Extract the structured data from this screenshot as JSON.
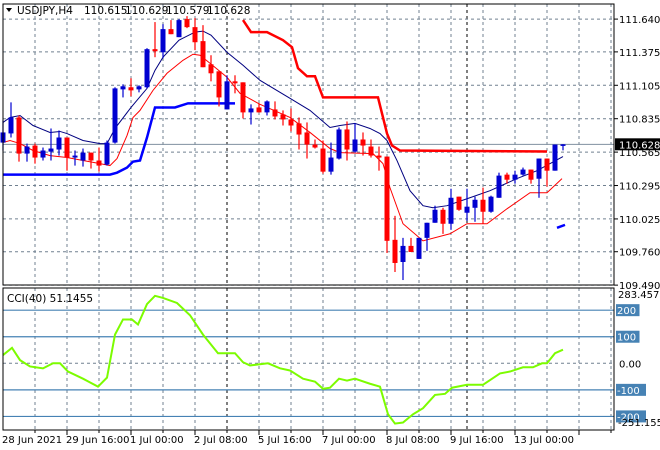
{
  "header": {
    "symbol_timeframe": "USDJPY,H4",
    "open": "110.615",
    "high": "110.629",
    "low": "110.579",
    "close": "110.628",
    "menu_icon": "triangle-down-icon"
  },
  "colors": {
    "bull": "#0000d0",
    "bear": "#ff0000",
    "ma_fast": "#000080",
    "ma_slow": "#ff0000",
    "support": "#0000ff",
    "resistance": "#ff0000",
    "cci": "#7cfc00",
    "cci_level": "#4682b4",
    "grid": "#708090"
  },
  "chart_data": {
    "type": "candlestick",
    "symbol": "USDJPY",
    "timeframe": "H4",
    "price_ylim": [
      109.491,
      111.762
    ],
    "price_ticks": [
      "111.640",
      "111.375",
      "111.105",
      "110.835",
      "110.565",
      "110.295",
      "110.025",
      "109.760",
      "109.490"
    ],
    "current_price": "110.628",
    "grid": true,
    "grid_every_bars": 4,
    "period_separators": [
      28,
      58
    ],
    "time_labels": [
      {
        "bar": 0,
        "text": "28 Jun 2021"
      },
      {
        "bar": 8,
        "text": "29 Jun 16:00"
      },
      {
        "bar": 16,
        "text": "1 Jul 00:00"
      },
      {
        "bar": 24,
        "text": "2 Jul 08:00"
      },
      {
        "bar": 32,
        "text": "5 Jul 16:00"
      },
      {
        "bar": 40,
        "text": "7 Jul 00:00"
      },
      {
        "bar": 48,
        "text": "8 Jul 08:00"
      },
      {
        "bar": 56,
        "text": "9 Jul 16:00"
      },
      {
        "bar": 64,
        "text": "13 Jul 00:00"
      }
    ],
    "candles_ohlc": [
      [
        110.642,
        110.821,
        110.578,
        110.724
      ],
      [
        110.716,
        110.967,
        110.683,
        110.845
      ],
      [
        110.845,
        110.861,
        110.488,
        110.553
      ],
      [
        110.553,
        110.634,
        110.488,
        110.61
      ],
      [
        110.618,
        110.634,
        110.472,
        110.521
      ],
      [
        110.521,
        110.602,
        110.497,
        110.578
      ],
      [
        110.569,
        110.756,
        110.497,
        110.594
      ],
      [
        110.586,
        110.74,
        110.537,
        110.683
      ],
      [
        110.683,
        110.683,
        110.415,
        110.521
      ],
      [
        110.521,
        110.578,
        110.456,
        110.537
      ],
      [
        110.497,
        110.594,
        110.448,
        110.561
      ],
      [
        110.561,
        110.561,
        110.432,
        110.497
      ],
      [
        110.497,
        110.602,
        110.407,
        110.456
      ],
      [
        110.464,
        110.659,
        110.456,
        110.642
      ],
      [
        110.642,
        111.089,
        110.634,
        111.08
      ],
      [
        111.072,
        111.113,
        111.007,
        111.097
      ],
      [
        111.089,
        111.162,
        111.016,
        111.064
      ],
      [
        111.072,
        111.105,
        111.048,
        111.097
      ],
      [
        111.089,
        111.405,
        111.08,
        111.397
      ],
      [
        111.397,
        111.616,
        111.332,
        111.38
      ],
      [
        111.372,
        111.599,
        111.324,
        111.559
      ],
      [
        111.559,
        111.632,
        111.518,
        111.518
      ],
      [
        111.494,
        111.64,
        111.494,
        111.632
      ],
      [
        111.64,
        111.664,
        111.567,
        111.575
      ],
      [
        111.575,
        111.648,
        111.389,
        111.453
      ],
      [
        111.462,
        111.591,
        111.251,
        111.251
      ],
      [
        111.275,
        111.348,
        111.137,
        111.202
      ],
      [
        111.218,
        111.218,
        110.934,
        111.007
      ],
      [
        110.91,
        111.186,
        110.91,
        111.137
      ],
      [
        111.137,
        111.186,
        111.04,
        111.121
      ],
      [
        111.129,
        111.129,
        110.837,
        110.886
      ],
      [
        110.886,
        110.951,
        110.788,
        110.918
      ],
      [
        110.926,
        110.959,
        110.886,
        110.886
      ],
      [
        110.886,
        110.983,
        110.861,
        110.975
      ],
      [
        110.91,
        110.975,
        110.829,
        110.853
      ],
      [
        110.87,
        110.902,
        110.78,
        110.829
      ],
      [
        110.829,
        110.918,
        110.732,
        110.78
      ],
      [
        110.797,
        110.845,
        110.586,
        110.707
      ],
      [
        110.724,
        110.805,
        110.513,
        110.626
      ],
      [
        110.626,
        110.667,
        110.594,
        110.602
      ],
      [
        110.594,
        110.659,
        110.391,
        110.407
      ],
      [
        110.407,
        110.642,
        110.383,
        110.521
      ],
      [
        110.513,
        110.764,
        110.505,
        110.748
      ],
      [
        110.748,
        110.813,
        110.497,
        110.586
      ],
      [
        110.569,
        110.797,
        110.561,
        110.667
      ],
      [
        110.667,
        110.724,
        110.537,
        110.618
      ],
      [
        110.61,
        110.667,
        110.521,
        110.537
      ],
      [
        110.537,
        110.61,
        110.415,
        110.521
      ],
      [
        110.529,
        110.529,
        109.75,
        109.848
      ],
      [
        109.856,
        110.05,
        109.596,
        109.669
      ],
      [
        109.677,
        109.872,
        109.531,
        109.807
      ],
      [
        109.807,
        109.872,
        109.758,
        109.758
      ],
      [
        109.702,
        109.872,
        109.702,
        109.872
      ],
      [
        109.872,
        109.994,
        109.767,
        109.994
      ],
      [
        109.994,
        110.132,
        109.994,
        110.099
      ],
      [
        110.099,
        110.115,
        109.904,
        109.986
      ],
      [
        109.986,
        110.269,
        109.937,
        110.196
      ],
      [
        110.205,
        110.205,
        110.091,
        110.099
      ],
      [
        110.075,
        110.269,
        110.01,
        110.124
      ],
      [
        110.115,
        110.205,
        110.002,
        110.18
      ],
      [
        110.18,
        110.278,
        109.986,
        110.083
      ],
      [
        110.083,
        110.213,
        110.075,
        110.205
      ],
      [
        110.196,
        110.399,
        110.196,
        110.375
      ],
      [
        110.383,
        110.399,
        110.31,
        110.342
      ],
      [
        110.342,
        110.415,
        110.31,
        110.383
      ],
      [
        110.383,
        110.44,
        110.375,
        110.424
      ],
      [
        110.424,
        110.424,
        110.31,
        110.342
      ],
      [
        110.35,
        110.513,
        110.196,
        110.513
      ],
      [
        110.513,
        110.513,
        110.286,
        110.415
      ],
      [
        110.415,
        110.626,
        110.415,
        110.626
      ],
      [
        110.615,
        110.629,
        110.579,
        110.628
      ]
    ],
    "ma_fast": [
      [
        0,
        110.805
      ],
      [
        0.875,
        110.845
      ],
      [
        2.125,
        110.861
      ],
      [
        3.75,
        110.78
      ],
      [
        5.875,
        110.724
      ],
      [
        7.125,
        110.732
      ],
      [
        8,
        110.715
      ],
      [
        10,
        110.659
      ],
      [
        12.125,
        110.634
      ],
      [
        13,
        110.634
      ],
      [
        14,
        110.756
      ],
      [
        16,
        110.926
      ],
      [
        18,
        111.08
      ],
      [
        19,
        111.226
      ],
      [
        20,
        111.332
      ],
      [
        22,
        111.47
      ],
      [
        24,
        111.535
      ],
      [
        25,
        111.543
      ],
      [
        26,
        111.51
      ],
      [
        28,
        111.372
      ],
      [
        30,
        111.267
      ],
      [
        32.125,
        111.145
      ],
      [
        35.875,
        111.0
      ],
      [
        38.375,
        110.902
      ],
      [
        40.875,
        110.764
      ],
      [
        42.125,
        110.78
      ],
      [
        44,
        110.797
      ],
      [
        45.875,
        110.756
      ],
      [
        47.125,
        110.715
      ],
      [
        48,
        110.659
      ],
      [
        49.25,
        110.497
      ],
      [
        50.875,
        110.253
      ],
      [
        52.5,
        110.132
      ],
      [
        53.75,
        110.115
      ],
      [
        55.5,
        110.132
      ],
      [
        58,
        110.188
      ],
      [
        60.875,
        110.253
      ],
      [
        64.25,
        110.351
      ],
      [
        66.75,
        110.415
      ],
      [
        70,
        110.529
      ]
    ],
    "ma_slow": [
      [
        0,
        110.642
      ],
      [
        0.875,
        110.659
      ],
      [
        2.125,
        110.634
      ],
      [
        3.75,
        110.578
      ],
      [
        5.875,
        110.537
      ],
      [
        8,
        110.521
      ],
      [
        10,
        110.497
      ],
      [
        12.125,
        110.472
      ],
      [
        13.375,
        110.456
      ],
      [
        14.25,
        110.513
      ],
      [
        15.5,
        110.699
      ],
      [
        16.25,
        110.845
      ],
      [
        17.125,
        110.902
      ],
      [
        18.75,
        111.064
      ],
      [
        20.5,
        111.202
      ],
      [
        22.5,
        111.307
      ],
      [
        23.75,
        111.356
      ],
      [
        24.625,
        111.348
      ],
      [
        25.875,
        111.283
      ],
      [
        28,
        111.17
      ],
      [
        29.625,
        111.04
      ],
      [
        32.125,
        110.951
      ],
      [
        35.875,
        110.845
      ],
      [
        38.375,
        110.724
      ],
      [
        40.875,
        110.594
      ],
      [
        42.125,
        110.561
      ],
      [
        46.25,
        110.553
      ],
      [
        47.5,
        110.472
      ],
      [
        48.375,
        110.277
      ],
      [
        50,
        109.986
      ],
      [
        52.5,
        109.848
      ],
      [
        55.875,
        109.905
      ],
      [
        58,
        109.986
      ],
      [
        60.5,
        109.986
      ],
      [
        63,
        110.107
      ],
      [
        65.875,
        110.237
      ],
      [
        68,
        110.237
      ],
      [
        69.875,
        110.351
      ]
    ],
    "support_line": [
      [
        0,
        110.383
      ],
      [
        13.375,
        110.383
      ],
      [
        14.25,
        110.399
      ],
      [
        15.5,
        110.44
      ],
      [
        16.25,
        110.488
      ],
      [
        17.125,
        110.497
      ],
      [
        18,
        110.683
      ],
      [
        19,
        110.926
      ],
      [
        21.5,
        110.926
      ],
      [
        23.125,
        110.959
      ],
      [
        29,
        110.959
      ]
    ],
    "support_line_2": [
      [
        69.25,
        109.953
      ],
      [
        70.25,
        109.977
      ]
    ],
    "resistance_line": [
      [
        30,
        111.632
      ],
      [
        31,
        111.535
      ],
      [
        33,
        111.535
      ],
      [
        35,
        111.47
      ],
      [
        36.125,
        111.413
      ],
      [
        36.875,
        111.243
      ],
      [
        38,
        111.178
      ],
      [
        39,
        111.178
      ],
      [
        40,
        111.007
      ],
      [
        46.875,
        111.007
      ],
      [
        48,
        110.716
      ],
      [
        48.625,
        110.618
      ],
      [
        49.625,
        110.578
      ],
      [
        68,
        110.57
      ]
    ],
    "cci": {
      "label": "CCI(40) 51.1455",
      "ylim": [
        -251.1553,
        283.4578
      ],
      "max_label": "283.4578",
      "min_label": "-251.1553",
      "levels": [
        "200",
        "100",
        "-100",
        "-200"
      ],
      "zero_label": "0.00",
      "points": [
        [
          0,
          31
        ],
        [
          1.125,
          58
        ],
        [
          2.125,
          12
        ],
        [
          3.375,
          -12
        ],
        [
          5,
          -19
        ],
        [
          6.25,
          0
        ],
        [
          7.125,
          0
        ],
        [
          8.125,
          -31
        ],
        [
          10,
          -58
        ],
        [
          11.875,
          -88
        ],
        [
          13,
          -54
        ],
        [
          14,
          108
        ],
        [
          15,
          165
        ],
        [
          16.125,
          165
        ],
        [
          16.875,
          146
        ],
        [
          18,
          223
        ],
        [
          19,
          254
        ],
        [
          20,
          246
        ],
        [
          21.75,
          227
        ],
        [
          23.375,
          181
        ],
        [
          25,
          108
        ],
        [
          26.875,
          38
        ],
        [
          29,
          38
        ],
        [
          30,
          4
        ],
        [
          30.875,
          -8
        ],
        [
          33.125,
          0
        ],
        [
          34.625,
          -19
        ],
        [
          35.875,
          -27
        ],
        [
          37.5,
          -58
        ],
        [
          39,
          -69
        ],
        [
          40,
          -96
        ],
        [
          40.875,
          -92
        ],
        [
          42,
          -58
        ],
        [
          43,
          -65
        ],
        [
          44,
          -58
        ],
        [
          45.875,
          -77
        ],
        [
          47.125,
          -88
        ],
        [
          48.125,
          -192
        ],
        [
          49,
          -227
        ],
        [
          50,
          -223
        ],
        [
          51.25,
          -192
        ],
        [
          52.5,
          -169
        ],
        [
          54,
          -119
        ],
        [
          55.25,
          -115
        ],
        [
          56.125,
          -92
        ],
        [
          58,
          -81
        ],
        [
          60,
          -81
        ],
        [
          62.125,
          -38
        ],
        [
          63.375,
          -31
        ],
        [
          65,
          -15
        ],
        [
          66.25,
          -15
        ],
        [
          67.375,
          0
        ],
        [
          68,
          0
        ],
        [
          69,
          38
        ],
        [
          70,
          51.1455
        ]
      ]
    }
  }
}
